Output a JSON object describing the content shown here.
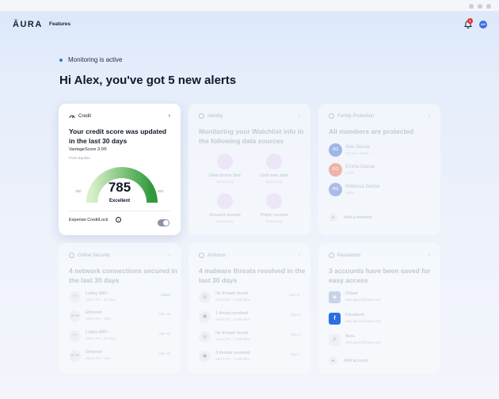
{
  "window": {
    "title_dots": 3
  },
  "nav": {
    "logo": "ĀURA",
    "link": "Features",
    "notifications": "1",
    "avatar_initials": "AG"
  },
  "status": {
    "text": "Monitoring is active"
  },
  "greeting": "Hi Alex, you've got 5 new alerts",
  "credit": {
    "label": "Credit",
    "title": "Your credit score was updated in the last 30 days",
    "model": "VantageScore 3.0®",
    "source": "From Equifax",
    "score": "785",
    "rating": "Excellent",
    "min": "280",
    "max": "850",
    "score_fraction": 0.89,
    "lock_label": "Experian CreditLock"
  },
  "identity": {
    "label": "Identity",
    "title": "Monitoring your Watchlist info in the following data sources",
    "items": [
      {
        "title": "Data broker lists",
        "sub": "Monitoring"
      },
      {
        "title": "Dark web sites",
        "sub": "Monitoring"
      },
      {
        "title": "Account records",
        "sub": "Monitoring"
      },
      {
        "title": "Public records",
        "sub": "Monitoring"
      }
    ]
  },
  "family": {
    "label": "Family Protection",
    "title": "All members are protected",
    "members": [
      {
        "initials": "AG",
        "name": "Alex Garcia",
        "role": "Account owner",
        "color": "#9fb6e8"
      },
      {
        "initials": "EG",
        "name": "Emma Garcia",
        "role": "Child",
        "color": "#efb3a8"
      },
      {
        "initials": "RG",
        "name": "Rebecca Garcia",
        "role": "Adult",
        "color": "#a9bde8"
      }
    ],
    "add": "Add a member"
  },
  "security": {
    "label": "Online Security",
    "title": "4 network connections secured in the last 30 days",
    "rows": [
      {
        "name": "Lobby-WiFi",
        "sub": "Alex's PC · 8r:31m",
        "meta": "Active"
      },
      {
        "name": "Ethernet",
        "sub": "Alex's PC · 24m",
        "meta": "Mar 15"
      },
      {
        "name": "Lobby-WiFi",
        "sub": "Alex's PC · 8r:31m",
        "meta": "Mar 15"
      },
      {
        "name": "Ethernet",
        "sub": "Alex's PC · 24m",
        "meta": "Mar 15"
      }
    ]
  },
  "antivirus": {
    "label": "Antivirus",
    "title": "4 malware threats resolved in the last 30 days",
    "rows": [
      {
        "name": "No threats found",
        "sub": "Alex's PC · 2,300 files",
        "meta": "Mar 11"
      },
      {
        "name": "1 threat resolved",
        "sub": "Alex's PC · 2,300 files",
        "meta": "Mar 8"
      },
      {
        "name": "No threats found",
        "sub": "Alex's PC · 2,300 files",
        "meta": "Mar 6"
      },
      {
        "name": "3 threats resolved",
        "sub": "Alex's PC · 2,300 files",
        "meta": "Mar 1"
      }
    ]
  },
  "passwords": {
    "label": "Passwords",
    "title": "3 accounts have been saved for easy access",
    "rows": [
      {
        "name": "Chase",
        "sub": "alex.garcia@aura.com",
        "color": "#c6d3e8"
      },
      {
        "name": "Facebook",
        "sub": "alex.garcia@aura.com",
        "color": "#2d6fe0"
      },
      {
        "name": "Aura",
        "sub": "alex.garcia@aura.com",
        "color": "#eef0f5"
      }
    ],
    "add": "Add account"
  }
}
